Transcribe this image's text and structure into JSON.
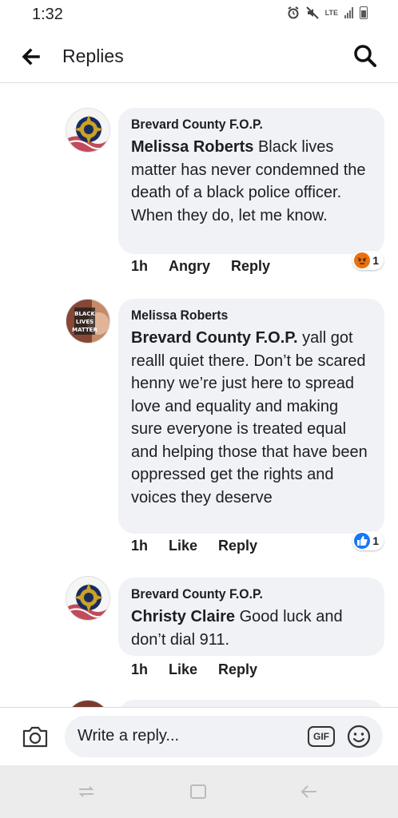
{
  "status_bar": {
    "time": "1:32",
    "network_label": "LTE",
    "icons": [
      "alarm-icon",
      "mute-icon",
      "signal-icon",
      "battery-icon"
    ]
  },
  "header": {
    "title": "Replies",
    "back_icon": "arrow-left-icon",
    "search_icon": "search-icon"
  },
  "comments": [
    {
      "author": "Brevard County F.O.P.",
      "mention": "Melissa Roberts",
      "text": " Black lives matter has never condemned the death of a black police officer. When they do, let me know.",
      "time": "1h",
      "reaction_label": "Angry",
      "reply_label": "Reply",
      "reaction": {
        "type": "angry",
        "count": "1",
        "color": "#e9710f"
      }
    },
    {
      "author": "Melissa Roberts",
      "mention": "Brevard County F.O.P.",
      "text": " yall got realll quiet there. Don’t be scared henny we’re just here to spread love and equality and making sure everyone is treated equal and helping those that have been oppressed get the rights and voices they deserve",
      "time": "1h",
      "reaction_label": "Like",
      "reply_label": "Reply",
      "reaction": {
        "type": "like",
        "count": "1",
        "color": "#1877f2"
      },
      "avatar_text": "BLACK LIVES MATTER"
    },
    {
      "author": "Brevard County F.O.P.",
      "mention": "Christy Claire",
      "text": " Good luck and don’t dial 911.",
      "time": "1h",
      "reaction_label": "Like",
      "reply_label": "Reply"
    }
  ],
  "composer": {
    "placeholder": "Write a reply...",
    "gif_label": "GIF",
    "icons": [
      "camera-icon",
      "gif-icon",
      "emoji-icon"
    ]
  },
  "navigation": {
    "icons": [
      "recent-apps-icon",
      "home-icon",
      "back-icon"
    ]
  },
  "colors": {
    "bubble_bg": "#f0f2f5",
    "text": "#1c1e21",
    "like_blue": "#1877f2",
    "angry_orange": "#e9710f"
  }
}
